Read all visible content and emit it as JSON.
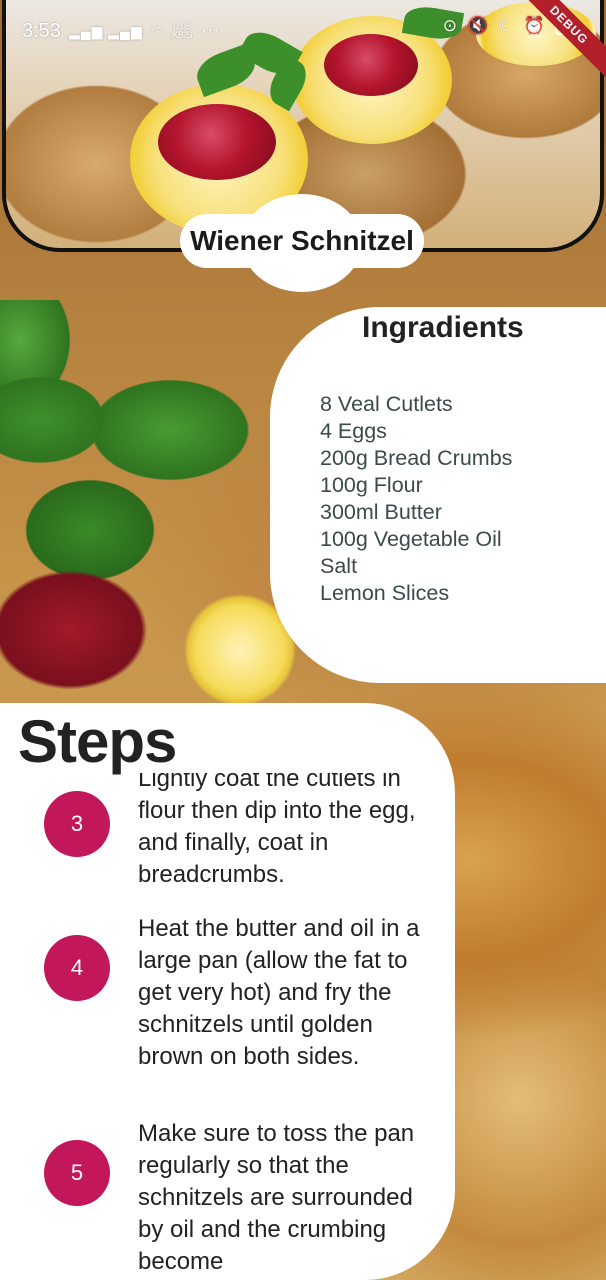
{
  "status_bar": {
    "time": "3:53",
    "net_speed_value": "0.05",
    "net_speed_unit": "KB/S",
    "more": "···",
    "battery": "51"
  },
  "debug_banner": "DEBUG",
  "recipe": {
    "title": "Wiener Schnitzel"
  },
  "ingredients": {
    "heading": "Ingradients",
    "items": [
      "8 Veal Cutlets",
      "4 Eggs",
      "200g Bread Crumbs",
      "100g Flour",
      "300ml Butter",
      "100g Vegetable Oil",
      "Salt",
      "Lemon Slices"
    ]
  },
  "steps": {
    "heading": "Steps",
    "items": [
      {
        "number": "3",
        "text": "Lightly coat the cutlets in flour then dip into the egg, and finally, coat in breadcrumbs."
      },
      {
        "number": "4",
        "text": "Heat the butter and oil in a large pan (allow the fat to get very hot) and fry the schnitzels until golden brown on both sides."
      },
      {
        "number": "5",
        "text": "Make sure to toss the pan regularly so that the schnitzels are surrounded by oil and the crumbing become"
      }
    ]
  },
  "colors": {
    "step_badge": "#c2185b",
    "panel_bg": "#ffffff",
    "debug_banner": "#b31f2a"
  }
}
